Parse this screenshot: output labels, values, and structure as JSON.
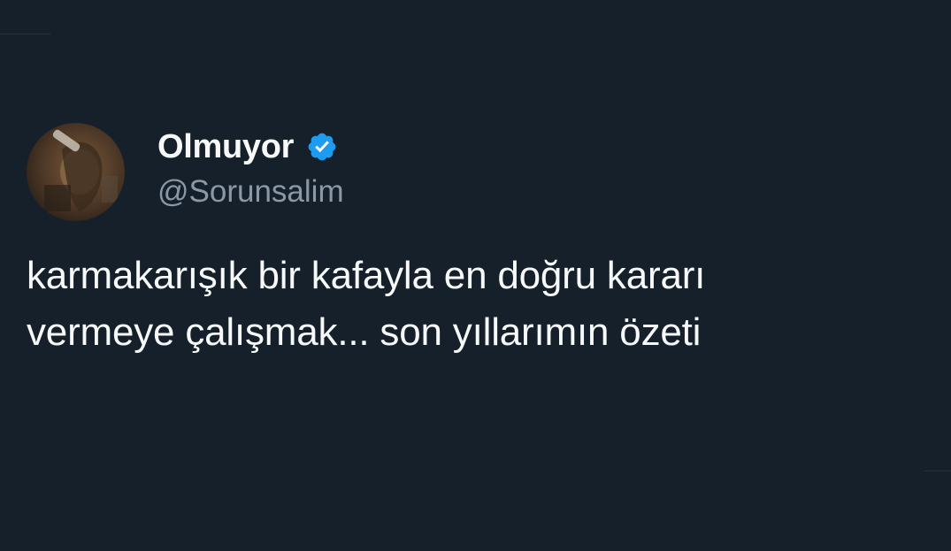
{
  "tweet": {
    "author": {
      "display_name": "Olmuyor",
      "handle": "@Sorunsalim",
      "verified": true,
      "avatar_icon": "profile-photo"
    },
    "text_lines": [
      "karmakarışık bir kafayla en doğru kararı",
      "vermeye çalışmak... son yıllarımın özeti"
    ]
  },
  "colors": {
    "background": "#15202b",
    "primary_text": "#f7f9f9",
    "secondary_text": "#8b98a5",
    "verified_badge": "#1d9bf0"
  }
}
